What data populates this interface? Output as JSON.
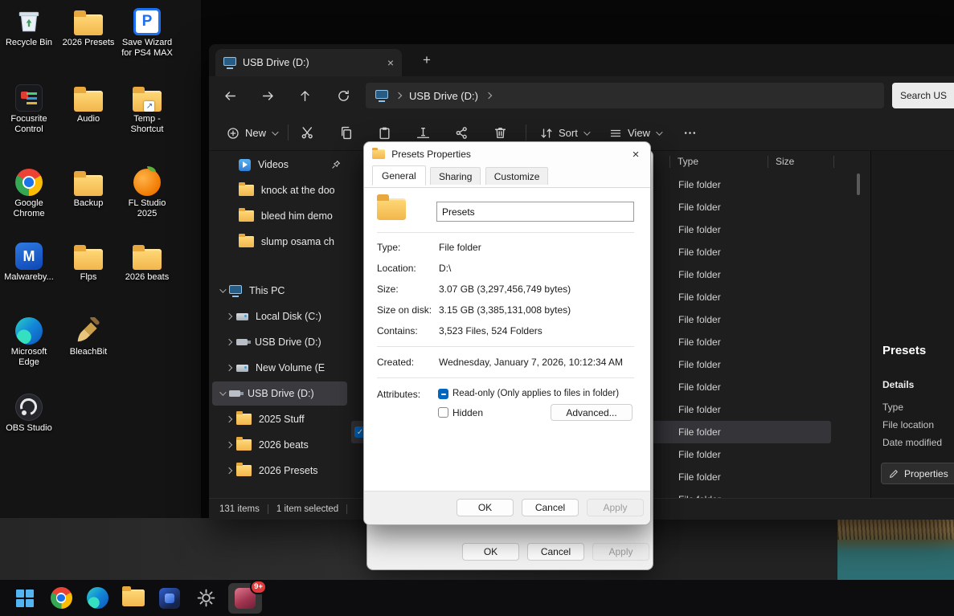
{
  "desktop": {
    "icons": [
      {
        "label": "Recycle Bin"
      },
      {
        "label": "2026 Presets"
      },
      {
        "label": "Save Wizard for PS4 MAX"
      },
      {
        "label": "Focusrite Control"
      },
      {
        "label": "Audio"
      },
      {
        "label": "Temp - Shortcut"
      },
      {
        "label": "Google Chrome"
      },
      {
        "label": "Backup"
      },
      {
        "label": "FL Studio 2025"
      },
      {
        "label": "Malwareby..."
      },
      {
        "label": "Flps"
      },
      {
        "label": "2026 beats"
      },
      {
        "label": "Microsoft Edge"
      },
      {
        "label": "BleachBit"
      },
      {
        "label": "OBS Studio"
      }
    ]
  },
  "explorer": {
    "tab": {
      "title": "USB Drive (D:)",
      "close": "×",
      "new_tab": "+"
    },
    "nav": {
      "breadcrumb": "USB Drive (D:)",
      "search": "Search US"
    },
    "toolbar": {
      "new_label": "New",
      "sort_label": "Sort",
      "view_label": "View"
    },
    "sidebar": {
      "items": [
        {
          "label": "Videos"
        },
        {
          "label": "knock at the doo"
        },
        {
          "label": "bleed him demo"
        },
        {
          "label": "slump osama ch"
        },
        {
          "label": "This PC"
        },
        {
          "label": "Local Disk (C:)"
        },
        {
          "label": "USB Drive (D:)"
        },
        {
          "label": "New Volume (E"
        },
        {
          "label": "USB Drive (D:)"
        },
        {
          "label": "2025 Stuff"
        },
        {
          "label": "2026 beats"
        },
        {
          "label": "2026 Presets"
        }
      ]
    },
    "list": {
      "columns": [
        "Type",
        "Size"
      ],
      "rows": [
        "File folder",
        "File folder",
        "File folder",
        "File folder",
        "File folder",
        "File folder",
        "File folder",
        "File folder",
        "File folder",
        "File folder",
        "File folder",
        "File folder",
        "File folder",
        "File folder",
        "File folder"
      ]
    },
    "details": {
      "title": "Presets",
      "heading": "Details",
      "fields": [
        "Type",
        "File location",
        "Date modified"
      ],
      "properties_button": "Properties"
    },
    "status": {
      "items": "131 items",
      "selected": "1 item selected"
    }
  },
  "dialog": {
    "title": "Presets Properties",
    "close": "×",
    "tabs": [
      "General",
      "Sharing",
      "Customize"
    ],
    "name_value": "Presets",
    "fields": [
      {
        "label": "Type:",
        "value": "File folder"
      },
      {
        "label": "Location:",
        "value": "D:\\"
      },
      {
        "label": "Size:",
        "value": "3.07 GB (3,297,456,749 bytes)"
      },
      {
        "label": "Size on disk:",
        "value": "3.15 GB (3,385,131,008 bytes)"
      },
      {
        "label": "Contains:",
        "value": "3,523 Files, 524 Folders"
      }
    ],
    "created_label": "Created:",
    "created_value": "Wednesday, January 7, 2026, 10:12:34 AM",
    "attributes_label": "Attributes:",
    "readonly_label": "Read-only (Only applies to files in folder)",
    "hidden_label": "Hidden",
    "advanced_button": "Advanced...",
    "ok": "OK",
    "cancel": "Cancel",
    "apply": "Apply"
  },
  "dialog_behind": {
    "ok": "OK",
    "cancel": "Cancel",
    "apply": "Apply"
  },
  "taskbar": {
    "badge": "9+"
  },
  "colors": {
    "accent": "#0067c0"
  }
}
